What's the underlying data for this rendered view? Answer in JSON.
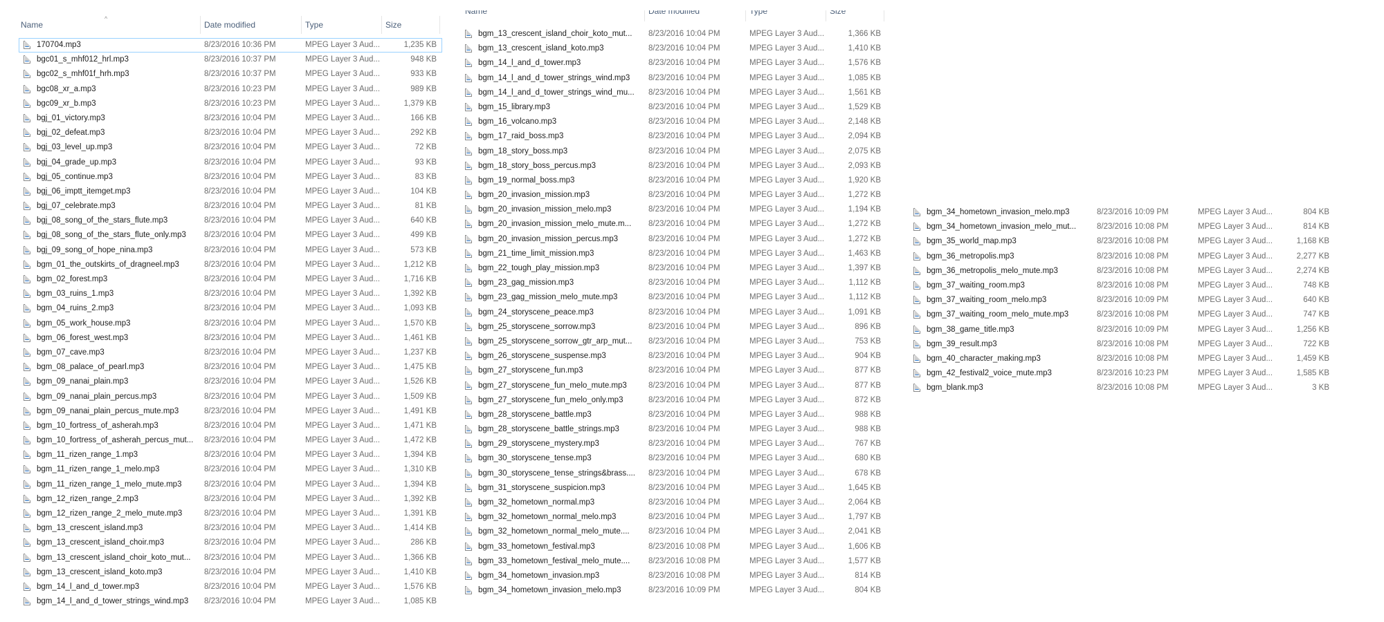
{
  "columns": {
    "name": "Name",
    "date": "Date modified",
    "type": "Type",
    "size": "Size"
  },
  "sort_indicator": "^",
  "panel1": [
    {
      "name": "170704.mp3",
      "date": "8/23/2016 10:36 PM",
      "type": "MPEG Layer 3 Aud...",
      "size": "1,235 KB"
    },
    {
      "name": "bgc01_s_mhf012_hrl.mp3",
      "date": "8/23/2016 10:37 PM",
      "type": "MPEG Layer 3 Aud...",
      "size": "948 KB"
    },
    {
      "name": "bgc02_s_mhf01f_hrh.mp3",
      "date": "8/23/2016 10:37 PM",
      "type": "MPEG Layer 3 Aud...",
      "size": "933 KB"
    },
    {
      "name": "bgc08_xr_a.mp3",
      "date": "8/23/2016 10:23 PM",
      "type": "MPEG Layer 3 Aud...",
      "size": "989 KB"
    },
    {
      "name": "bgc09_xr_b.mp3",
      "date": "8/23/2016 10:23 PM",
      "type": "MPEG Layer 3 Aud...",
      "size": "1,379 KB"
    },
    {
      "name": "bgj_01_victory.mp3",
      "date": "8/23/2016 10:04 PM",
      "type": "MPEG Layer 3 Aud...",
      "size": "166 KB"
    },
    {
      "name": "bgj_02_defeat.mp3",
      "date": "8/23/2016 10:04 PM",
      "type": "MPEG Layer 3 Aud...",
      "size": "292 KB"
    },
    {
      "name": "bgj_03_level_up.mp3",
      "date": "8/23/2016 10:04 PM",
      "type": "MPEG Layer 3 Aud...",
      "size": "72 KB"
    },
    {
      "name": "bgj_04_grade_up.mp3",
      "date": "8/23/2016 10:04 PM",
      "type": "MPEG Layer 3 Aud...",
      "size": "93 KB"
    },
    {
      "name": "bgj_05_continue.mp3",
      "date": "8/23/2016 10:04 PM",
      "type": "MPEG Layer 3 Aud...",
      "size": "83 KB"
    },
    {
      "name": "bgj_06_imptt_itemget.mp3",
      "date": "8/23/2016 10:04 PM",
      "type": "MPEG Layer 3 Aud...",
      "size": "104 KB"
    },
    {
      "name": "bgj_07_celebrate.mp3",
      "date": "8/23/2016 10:04 PM",
      "type": "MPEG Layer 3 Aud...",
      "size": "81 KB"
    },
    {
      "name": "bgj_08_song_of_the_stars_flute.mp3",
      "date": "8/23/2016 10:04 PM",
      "type": "MPEG Layer 3 Aud...",
      "size": "640 KB"
    },
    {
      "name": "bgj_08_song_of_the_stars_flute_only.mp3",
      "date": "8/23/2016 10:04 PM",
      "type": "MPEG Layer 3 Aud...",
      "size": "499 KB"
    },
    {
      "name": "bgj_09_song_of_hope_nina.mp3",
      "date": "8/23/2016 10:04 PM",
      "type": "MPEG Layer 3 Aud...",
      "size": "573 KB"
    },
    {
      "name": "bgm_01_the_outskirts_of_dragneel.mp3",
      "date": "8/23/2016 10:04 PM",
      "type": "MPEG Layer 3 Aud...",
      "size": "1,212 KB"
    },
    {
      "name": "bgm_02_forest.mp3",
      "date": "8/23/2016 10:04 PM",
      "type": "MPEG Layer 3 Aud...",
      "size": "1,716 KB"
    },
    {
      "name": "bgm_03_ruins_1.mp3",
      "date": "8/23/2016 10:04 PM",
      "type": "MPEG Layer 3 Aud...",
      "size": "1,392 KB"
    },
    {
      "name": "bgm_04_ruins_2.mp3",
      "date": "8/23/2016 10:04 PM",
      "type": "MPEG Layer 3 Aud...",
      "size": "1,093 KB"
    },
    {
      "name": "bgm_05_work_house.mp3",
      "date": "8/23/2016 10:04 PM",
      "type": "MPEG Layer 3 Aud...",
      "size": "1,570 KB"
    },
    {
      "name": "bgm_06_forest_west.mp3",
      "date": "8/23/2016 10:04 PM",
      "type": "MPEG Layer 3 Aud...",
      "size": "1,461 KB"
    },
    {
      "name": "bgm_07_cave.mp3",
      "date": "8/23/2016 10:04 PM",
      "type": "MPEG Layer 3 Aud...",
      "size": "1,237 KB"
    },
    {
      "name": "bgm_08_palace_of_pearl.mp3",
      "date": "8/23/2016 10:04 PM",
      "type": "MPEG Layer 3 Aud...",
      "size": "1,475 KB"
    },
    {
      "name": "bgm_09_nanai_plain.mp3",
      "date": "8/23/2016 10:04 PM",
      "type": "MPEG Layer 3 Aud...",
      "size": "1,526 KB"
    },
    {
      "name": "bgm_09_nanai_plain_percus.mp3",
      "date": "8/23/2016 10:04 PM",
      "type": "MPEG Layer 3 Aud...",
      "size": "1,509 KB"
    },
    {
      "name": "bgm_09_nanai_plain_percus_mute.mp3",
      "date": "8/23/2016 10:04 PM",
      "type": "MPEG Layer 3 Aud...",
      "size": "1,491 KB"
    },
    {
      "name": "bgm_10_fortress_of_asherah.mp3",
      "date": "8/23/2016 10:04 PM",
      "type": "MPEG Layer 3 Aud...",
      "size": "1,471 KB"
    },
    {
      "name": "bgm_10_fortress_of_asherah_percus_mut...",
      "date": "8/23/2016 10:04 PM",
      "type": "MPEG Layer 3 Aud...",
      "size": "1,472 KB"
    },
    {
      "name": "bgm_11_rizen_range_1.mp3",
      "date": "8/23/2016 10:04 PM",
      "type": "MPEG Layer 3 Aud...",
      "size": "1,394 KB"
    },
    {
      "name": "bgm_11_rizen_range_1_melo.mp3",
      "date": "8/23/2016 10:04 PM",
      "type": "MPEG Layer 3 Aud...",
      "size": "1,310 KB"
    },
    {
      "name": "bgm_11_rizen_range_1_melo_mute.mp3",
      "date": "8/23/2016 10:04 PM",
      "type": "MPEG Layer 3 Aud...",
      "size": "1,394 KB"
    },
    {
      "name": "bgm_12_rizen_range_2.mp3",
      "date": "8/23/2016 10:04 PM",
      "type": "MPEG Layer 3 Aud...",
      "size": "1,392 KB"
    },
    {
      "name": "bgm_12_rizen_range_2_melo_mute.mp3",
      "date": "8/23/2016 10:04 PM",
      "type": "MPEG Layer 3 Aud...",
      "size": "1,391 KB"
    },
    {
      "name": "bgm_13_crescent_island.mp3",
      "date": "8/23/2016 10:04 PM",
      "type": "MPEG Layer 3 Aud...",
      "size": "1,414 KB"
    },
    {
      "name": "bgm_13_crescent_island_choir.mp3",
      "date": "8/23/2016 10:04 PM",
      "type": "MPEG Layer 3 Aud...",
      "size": "286 KB"
    },
    {
      "name": "bgm_13_crescent_island_choir_koto_mut...",
      "date": "8/23/2016 10:04 PM",
      "type": "MPEG Layer 3 Aud...",
      "size": "1,366 KB"
    },
    {
      "name": "bgm_13_crescent_island_koto.mp3",
      "date": "8/23/2016 10:04 PM",
      "type": "MPEG Layer 3 Aud...",
      "size": "1,410 KB"
    },
    {
      "name": "bgm_14_l_and_d_tower.mp3",
      "date": "8/23/2016 10:04 PM",
      "type": "MPEG Layer 3 Aud...",
      "size": "1,576 KB"
    },
    {
      "name": "bgm_14_l_and_d_tower_strings_wind.mp3",
      "date": "8/23/2016 10:04 PM",
      "type": "MPEG Layer 3 Aud...",
      "size": "1,085 KB"
    }
  ],
  "panel2": [
    {
      "name": "bgm_13_crescent_island_choir_koto_mut...",
      "date": "8/23/2016 10:04 PM",
      "type": "MPEG Layer 3 Aud...",
      "size": "1,366 KB"
    },
    {
      "name": "bgm_13_crescent_island_koto.mp3",
      "date": "8/23/2016 10:04 PM",
      "type": "MPEG Layer 3 Aud...",
      "size": "1,410 KB"
    },
    {
      "name": "bgm_14_l_and_d_tower.mp3",
      "date": "8/23/2016 10:04 PM",
      "type": "MPEG Layer 3 Aud...",
      "size": "1,576 KB"
    },
    {
      "name": "bgm_14_l_and_d_tower_strings_wind.mp3",
      "date": "8/23/2016 10:04 PM",
      "type": "MPEG Layer 3 Aud...",
      "size": "1,085 KB"
    },
    {
      "name": "bgm_14_l_and_d_tower_strings_wind_mu...",
      "date": "8/23/2016 10:04 PM",
      "type": "MPEG Layer 3 Aud...",
      "size": "1,561 KB"
    },
    {
      "name": "bgm_15_library.mp3",
      "date": "8/23/2016 10:04 PM",
      "type": "MPEG Layer 3 Aud...",
      "size": "1,529 KB"
    },
    {
      "name": "bgm_16_volcano.mp3",
      "date": "8/23/2016 10:04 PM",
      "type": "MPEG Layer 3 Aud...",
      "size": "2,148 KB"
    },
    {
      "name": "bgm_17_raid_boss.mp3",
      "date": "8/23/2016 10:04 PM",
      "type": "MPEG Layer 3 Aud...",
      "size": "2,094 KB"
    },
    {
      "name": "bgm_18_story_boss.mp3",
      "date": "8/23/2016 10:04 PM",
      "type": "MPEG Layer 3 Aud...",
      "size": "2,075 KB"
    },
    {
      "name": "bgm_18_story_boss_percus.mp3",
      "date": "8/23/2016 10:04 PM",
      "type": "MPEG Layer 3 Aud...",
      "size": "2,093 KB"
    },
    {
      "name": "bgm_19_normal_boss.mp3",
      "date": "8/23/2016 10:04 PM",
      "type": "MPEG Layer 3 Aud...",
      "size": "1,920 KB"
    },
    {
      "name": "bgm_20_invasion_mission.mp3",
      "date": "8/23/2016 10:04 PM",
      "type": "MPEG Layer 3 Aud...",
      "size": "1,272 KB"
    },
    {
      "name": "bgm_20_invasion_mission_melo.mp3",
      "date": "8/23/2016 10:04 PM",
      "type": "MPEG Layer 3 Aud...",
      "size": "1,194 KB"
    },
    {
      "name": "bgm_20_invasion_mission_melo_mute.m...",
      "date": "8/23/2016 10:04 PM",
      "type": "MPEG Layer 3 Aud...",
      "size": "1,272 KB"
    },
    {
      "name": "bgm_20_invasion_mission_percus.mp3",
      "date": "8/23/2016 10:04 PM",
      "type": "MPEG Layer 3 Aud...",
      "size": "1,272 KB"
    },
    {
      "name": "bgm_21_time_limit_mission.mp3",
      "date": "8/23/2016 10:04 PM",
      "type": "MPEG Layer 3 Aud...",
      "size": "1,463 KB"
    },
    {
      "name": "bgm_22_tough_play_mission.mp3",
      "date": "8/23/2016 10:04 PM",
      "type": "MPEG Layer 3 Aud...",
      "size": "1,397 KB"
    },
    {
      "name": "bgm_23_gag_mission.mp3",
      "date": "8/23/2016 10:04 PM",
      "type": "MPEG Layer 3 Aud...",
      "size": "1,112 KB"
    },
    {
      "name": "bgm_23_gag_mission_melo_mute.mp3",
      "date": "8/23/2016 10:04 PM",
      "type": "MPEG Layer 3 Aud...",
      "size": "1,112 KB"
    },
    {
      "name": "bgm_24_storyscene_peace.mp3",
      "date": "8/23/2016 10:04 PM",
      "type": "MPEG Layer 3 Aud...",
      "size": "1,091 KB"
    },
    {
      "name": "bgm_25_storyscene_sorrow.mp3",
      "date": "8/23/2016 10:04 PM",
      "type": "MPEG Layer 3 Aud...",
      "size": "896 KB"
    },
    {
      "name": "bgm_25_storyscene_sorrow_gtr_arp_mut...",
      "date": "8/23/2016 10:04 PM",
      "type": "MPEG Layer 3 Aud...",
      "size": "753 KB"
    },
    {
      "name": "bgm_26_storyscene_suspense.mp3",
      "date": "8/23/2016 10:04 PM",
      "type": "MPEG Layer 3 Aud...",
      "size": "904 KB"
    },
    {
      "name": "bgm_27_storyscene_fun.mp3",
      "date": "8/23/2016 10:04 PM",
      "type": "MPEG Layer 3 Aud...",
      "size": "877 KB"
    },
    {
      "name": "bgm_27_storyscene_fun_melo_mute.mp3",
      "date": "8/23/2016 10:04 PM",
      "type": "MPEG Layer 3 Aud...",
      "size": "877 KB"
    },
    {
      "name": "bgm_27_storyscene_fun_melo_only.mp3",
      "date": "8/23/2016 10:04 PM",
      "type": "MPEG Layer 3 Aud...",
      "size": "872 KB"
    },
    {
      "name": "bgm_28_storyscene_battle.mp3",
      "date": "8/23/2016 10:04 PM",
      "type": "MPEG Layer 3 Aud...",
      "size": "988 KB"
    },
    {
      "name": "bgm_28_storyscene_battle_strings.mp3",
      "date": "8/23/2016 10:04 PM",
      "type": "MPEG Layer 3 Aud...",
      "size": "988 KB"
    },
    {
      "name": "bgm_29_storyscene_mystery.mp3",
      "date": "8/23/2016 10:04 PM",
      "type": "MPEG Layer 3 Aud...",
      "size": "767 KB"
    },
    {
      "name": "bgm_30_storyscene_tense.mp3",
      "date": "8/23/2016 10:04 PM",
      "type": "MPEG Layer 3 Aud...",
      "size": "680 KB"
    },
    {
      "name": "bgm_30_storyscene_tense_strings&brass....",
      "date": "8/23/2016 10:04 PM",
      "type": "MPEG Layer 3 Aud...",
      "size": "678 KB"
    },
    {
      "name": "bgm_31_storyscene_suspicion.mp3",
      "date": "8/23/2016 10:04 PM",
      "type": "MPEG Layer 3 Aud...",
      "size": "1,645 KB"
    },
    {
      "name": "bgm_32_hometown_normal.mp3",
      "date": "8/23/2016 10:04 PM",
      "type": "MPEG Layer 3 Aud...",
      "size": "2,064 KB"
    },
    {
      "name": "bgm_32_hometown_normal_melo.mp3",
      "date": "8/23/2016 10:04 PM",
      "type": "MPEG Layer 3 Aud...",
      "size": "1,797 KB"
    },
    {
      "name": "bgm_32_hometown_normal_melo_mute....",
      "date": "8/23/2016 10:04 PM",
      "type": "MPEG Layer 3 Aud...",
      "size": "2,041 KB"
    },
    {
      "name": "bgm_33_hometown_festival.mp3",
      "date": "8/23/2016 10:08 PM",
      "type": "MPEG Layer 3 Aud...",
      "size": "1,606 KB"
    },
    {
      "name": "bgm_33_hometown_festival_melo_mute....",
      "date": "8/23/2016 10:08 PM",
      "type": "MPEG Layer 3 Aud...",
      "size": "1,577 KB"
    },
    {
      "name": "bgm_34_hometown_invasion.mp3",
      "date": "8/23/2016 10:08 PM",
      "type": "MPEG Layer 3 Aud...",
      "size": "814 KB"
    },
    {
      "name": "bgm_34_hometown_invasion_melo.mp3",
      "date": "8/23/2016 10:09 PM",
      "type": "MPEG Layer 3 Aud...",
      "size": "804 KB"
    }
  ],
  "panel3": [
    {
      "name": "bgm_34_hometown_invasion_melo.mp3",
      "date": "8/23/2016 10:09 PM",
      "type": "MPEG Layer 3 Aud...",
      "size": "804 KB"
    },
    {
      "name": "bgm_34_hometown_invasion_melo_mut...",
      "date": "8/23/2016 10:08 PM",
      "type": "MPEG Layer 3 Aud...",
      "size": "814 KB"
    },
    {
      "name": "bgm_35_world_map.mp3",
      "date": "8/23/2016 10:08 PM",
      "type": "MPEG Layer 3 Aud...",
      "size": "1,168 KB"
    },
    {
      "name": "bgm_36_metropolis.mp3",
      "date": "8/23/2016 10:08 PM",
      "type": "MPEG Layer 3 Aud...",
      "size": "2,277 KB"
    },
    {
      "name": "bgm_36_metropolis_melo_mute.mp3",
      "date": "8/23/2016 10:08 PM",
      "type": "MPEG Layer 3 Aud...",
      "size": "2,274 KB"
    },
    {
      "name": "bgm_37_waiting_room.mp3",
      "date": "8/23/2016 10:08 PM",
      "type": "MPEG Layer 3 Aud...",
      "size": "748 KB"
    },
    {
      "name": "bgm_37_waiting_room_melo.mp3",
      "date": "8/23/2016 10:09 PM",
      "type": "MPEG Layer 3 Aud...",
      "size": "640 KB"
    },
    {
      "name": "bgm_37_waiting_room_melo_mute.mp3",
      "date": "8/23/2016 10:08 PM",
      "type": "MPEG Layer 3 Aud...",
      "size": "747 KB"
    },
    {
      "name": "bgm_38_game_title.mp3",
      "date": "8/23/2016 10:09 PM",
      "type": "MPEG Layer 3 Aud...",
      "size": "1,256 KB"
    },
    {
      "name": "bgm_39_result.mp3",
      "date": "8/23/2016 10:08 PM",
      "type": "MPEG Layer 3 Aud...",
      "size": "722 KB"
    },
    {
      "name": "bgm_40_character_making.mp3",
      "date": "8/23/2016 10:08 PM",
      "type": "MPEG Layer 3 Aud...",
      "size": "1,459 KB"
    },
    {
      "name": "bgm_42_festival2_voice_mute.mp3",
      "date": "8/23/2016 10:23 PM",
      "type": "MPEG Layer 3 Aud...",
      "size": "1,585 KB"
    },
    {
      "name": "bgm_blank.mp3",
      "date": "8/23/2016 10:08 PM",
      "type": "MPEG Layer 3 Aud...",
      "size": "3 KB"
    }
  ]
}
